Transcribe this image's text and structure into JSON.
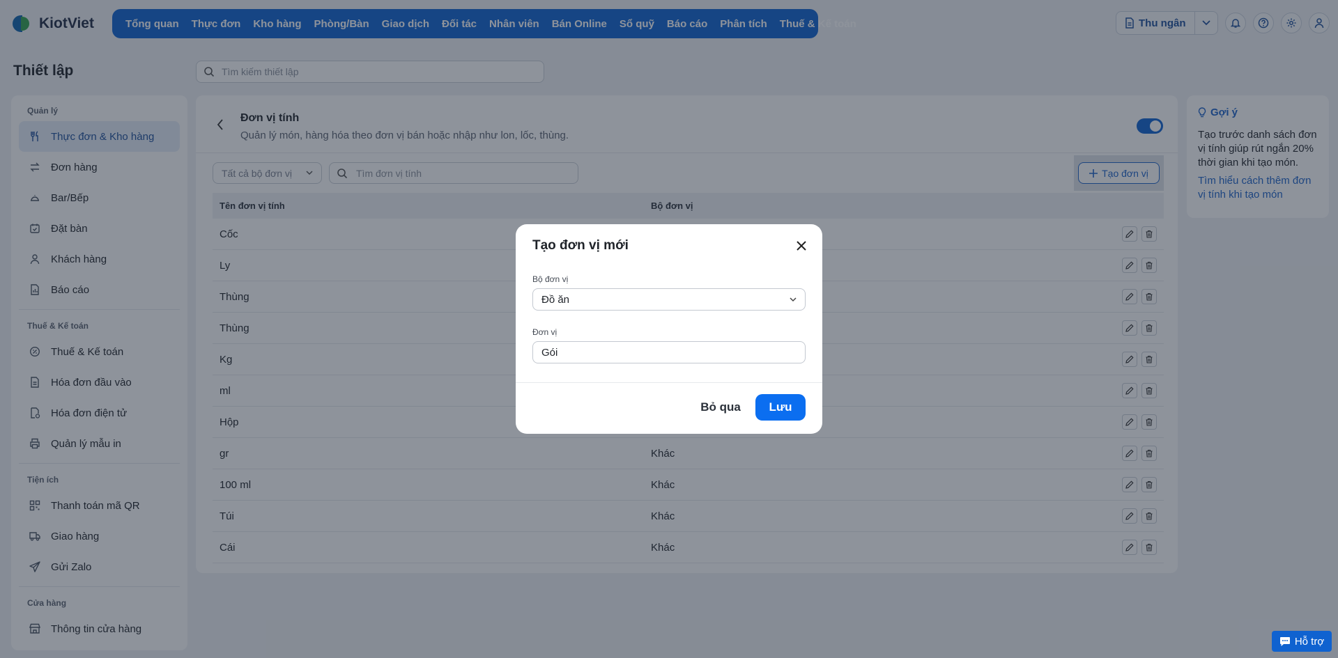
{
  "brand": {
    "name": "KiotViet"
  },
  "nav": [
    {
      "label": "Tổng quan"
    },
    {
      "label": "Thực đơn"
    },
    {
      "label": "Kho hàng"
    },
    {
      "label": "Phòng/Bàn"
    },
    {
      "label": "Giao dịch"
    },
    {
      "label": "Đối tác"
    },
    {
      "label": "Nhân viên"
    },
    {
      "label": "Bán Online"
    },
    {
      "label": "Sổ quỹ"
    },
    {
      "label": "Báo cáo"
    },
    {
      "label": "Phân tích"
    },
    {
      "label": "Thuế & Kế toán"
    }
  ],
  "topright": {
    "cashier_label": "Thu ngân"
  },
  "page": {
    "title": "Thiết lập",
    "search_placeholder": "Tìm kiếm thiết lập"
  },
  "sidebar": {
    "groups": [
      {
        "label": "Quản lý",
        "items": [
          {
            "label": "Thực đơn & Kho hàng",
            "icon": "utensils-icon",
            "active": true
          },
          {
            "label": "Đơn hàng",
            "icon": "swap-icon"
          },
          {
            "label": "Bar/Bếp",
            "icon": "kitchen-bell-icon"
          },
          {
            "label": "Đặt bàn",
            "icon": "calendar-check-icon"
          },
          {
            "label": "Khách hàng",
            "icon": "user-icon"
          },
          {
            "label": "Báo cáo",
            "icon": "report-icon"
          }
        ]
      },
      {
        "label": "Thuế & Kế toán",
        "items": [
          {
            "label": "Thuế & Kế toán",
            "icon": "tax-icon"
          },
          {
            "label": "Hóa đơn đầu vào",
            "icon": "invoice-icon"
          },
          {
            "label": "Hóa đơn điện tử",
            "icon": "e-invoice-icon"
          },
          {
            "label": "Quản lý mẫu in",
            "icon": "printer-icon"
          }
        ]
      },
      {
        "label": "Tiện ích",
        "items": [
          {
            "label": "Thanh toán mã QR",
            "icon": "qr-icon"
          },
          {
            "label": "Giao hàng",
            "icon": "truck-icon"
          },
          {
            "label": "Gửi Zalo",
            "icon": "send-icon"
          }
        ]
      },
      {
        "label": "Cửa hàng",
        "items": [
          {
            "label": "Thông tin cửa hàng",
            "icon": "store-icon"
          }
        ]
      }
    ]
  },
  "section": {
    "title": "Đơn vị tính",
    "subtitle": "Quản lý món, hàng hóa theo đơn vị bán hoặc nhập như lon, lốc, thùng.",
    "toggle_on": true,
    "filter_value": "Tất cả bộ đơn vị",
    "search_placeholder": "Tìm đơn vị tính",
    "create_label": "Tạo đơn vị"
  },
  "table": {
    "headers": [
      "Tên đơn vị tính",
      "Bộ đơn vị"
    ],
    "rows": [
      {
        "name": "Cốc",
        "group": ""
      },
      {
        "name": "Ly",
        "group": ""
      },
      {
        "name": "Thùng",
        "group": ""
      },
      {
        "name": "Thùng",
        "group": ""
      },
      {
        "name": "Kg",
        "group": ""
      },
      {
        "name": "ml",
        "group": ""
      },
      {
        "name": "Hộp",
        "group": ""
      },
      {
        "name": "gr",
        "group": "Khác"
      },
      {
        "name": "100 ml",
        "group": "Khác"
      },
      {
        "name": "Túi",
        "group": "Khác"
      },
      {
        "name": "Cái",
        "group": "Khác"
      }
    ]
  },
  "modal": {
    "title": "Tạo đơn vị mới",
    "group_label": "Bộ đơn vị",
    "group_value": "Đồ ăn",
    "unit_label": "Đơn vị",
    "unit_value": "Gói",
    "cancel_label": "Bỏ qua",
    "save_label": "Lưu"
  },
  "tips": {
    "title": "Gợi ý",
    "text": "Tạo trước danh sách đơn vị tính giúp rút ngắn 20% thời gian khi tạo món.",
    "link": "Tìm hiểu cách thêm đơn vị tính khi tạo món"
  },
  "support": {
    "label": "Hỗ trợ"
  },
  "colors": {
    "accent": "#0f62d0",
    "save": "#0b6ef0"
  }
}
